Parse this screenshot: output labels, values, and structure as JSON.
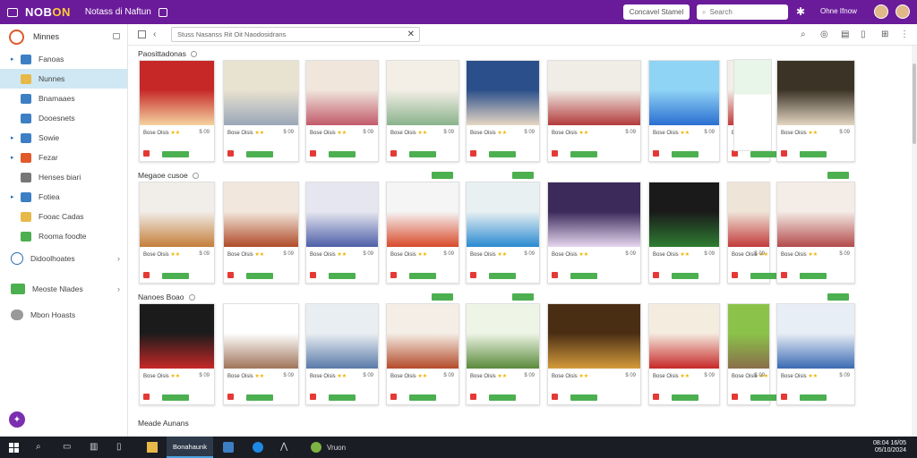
{
  "topbar": {
    "brand_a": "NOB",
    "brand_b": "ON",
    "app_title": "Notass di Naftun",
    "pill_label": "Concavel Stamel",
    "search_placeholder": "Search",
    "user_name": "Ohne Ifnow"
  },
  "sidebar": {
    "title": "Minnes",
    "items": [
      {
        "label": "Fanoas",
        "color": "#3d7fc4",
        "arrow": "▸"
      },
      {
        "label": "Nunnes",
        "color": "#e8b949",
        "arrow": ""
      },
      {
        "label": "Bnamaaes",
        "color": "#3d7fc4",
        "arrow": ""
      },
      {
        "label": "Dooesnets",
        "color": "#3d7fc4",
        "arrow": ""
      },
      {
        "label": "Sowie",
        "color": "#3d7fc4",
        "arrow": "▸"
      },
      {
        "label": "Fezar",
        "color": "#e05a2b",
        "arrow": "▸"
      },
      {
        "label": "Henses biari",
        "color": "#777777",
        "arrow": ""
      },
      {
        "label": "Fotiea",
        "color": "#3d7fc4",
        "arrow": "▸"
      },
      {
        "label": "Fooac Cadas",
        "color": "#e8b949",
        "arrow": ""
      },
      {
        "label": "Rooma foodte",
        "color": "#4caf50",
        "arrow": ""
      }
    ],
    "group1": "Didoolhoates",
    "group2": "Meoste Nlades",
    "group3": "Mbon Hoasts"
  },
  "toolbar": {
    "path": "Stuss   Nasanss   Rit   Oit   Naodosidrans"
  },
  "sections": [
    "Paosittadonas",
    "Megaoe cusoe",
    "Nanoes Boao",
    "Meade Aunans"
  ],
  "card_meta": {
    "left": "Bose Oisis",
    "right": "$ 09",
    "stars": "★★"
  },
  "taskbar": {
    "active_label": "Bonahaunk",
    "app_label": "Vruon",
    "time": "08:04 16/05",
    "date": "05/10/2024"
  }
}
